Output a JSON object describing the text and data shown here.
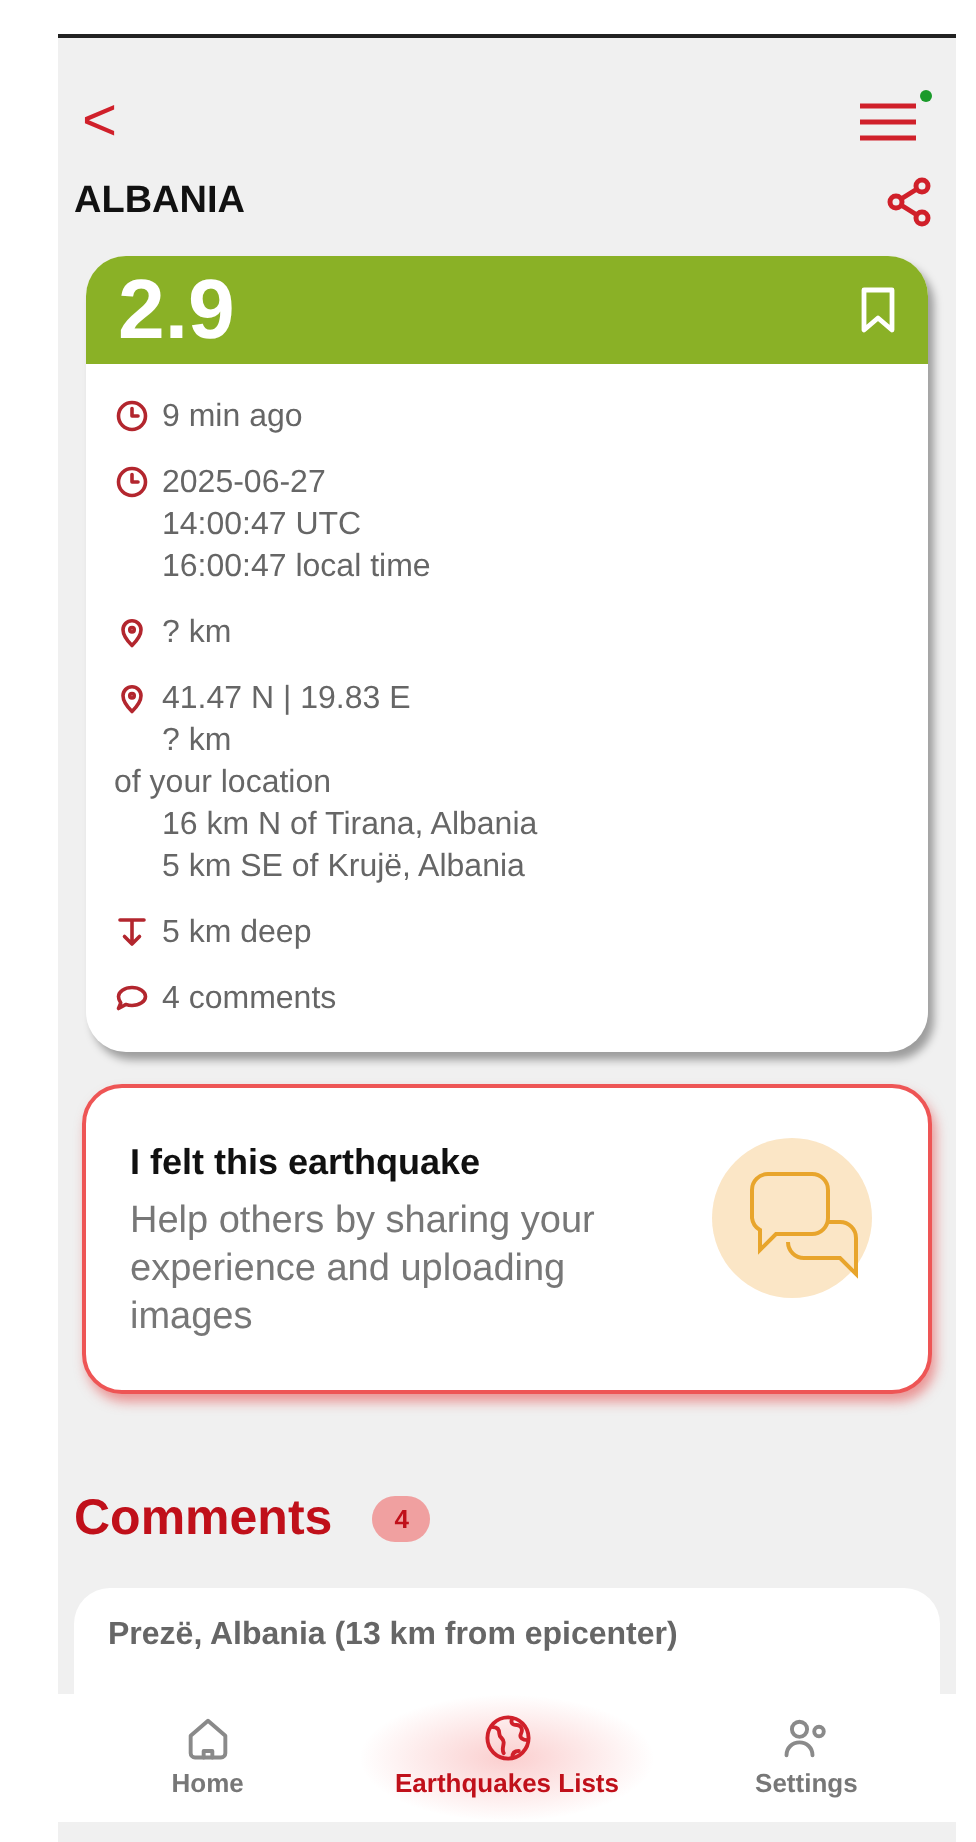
{
  "header": {
    "back": "<",
    "menu_notification": true
  },
  "region": "ALBANIA",
  "event": {
    "magnitude": "2.9",
    "color": "#8ab126",
    "bookmarked": false,
    "details": [
      {
        "kind": "clock",
        "lines": [
          "9 min ago"
        ]
      },
      {
        "kind": "clock",
        "lines": [
          "2025-06-27",
          "14:00:47 UTC",
          "16:00:47 local time"
        ]
      },
      {
        "kind": "pin",
        "lines": [
          "? km"
        ]
      },
      {
        "kind": "pin",
        "lines": [
          "41.47 N | 19.83 E",
          "? km"
        ],
        "after": [
          "of your location"
        ],
        "more": [
          "16 km N of Tirana, Albania",
          "5 km SE of Krujë, Albania"
        ]
      },
      {
        "kind": "depth",
        "lines": [
          "5 km deep"
        ]
      },
      {
        "kind": "comment",
        "lines": [
          "4 comments"
        ]
      }
    ]
  },
  "felt": {
    "title": "I felt this earthquake",
    "text": "Help others by sharing your experience and uploading images"
  },
  "comments": {
    "title": "Comments",
    "count": "4",
    "items": [
      {
        "place": "Prezë, Albania (13 km from epicenter)"
      }
    ]
  },
  "nav": [
    {
      "kind": "home",
      "label": "Home",
      "selected": false
    },
    {
      "kind": "globe",
      "label": "Earthquakes Lists",
      "selected": true
    },
    {
      "kind": "settings",
      "label": "Settings",
      "selected": false
    }
  ]
}
